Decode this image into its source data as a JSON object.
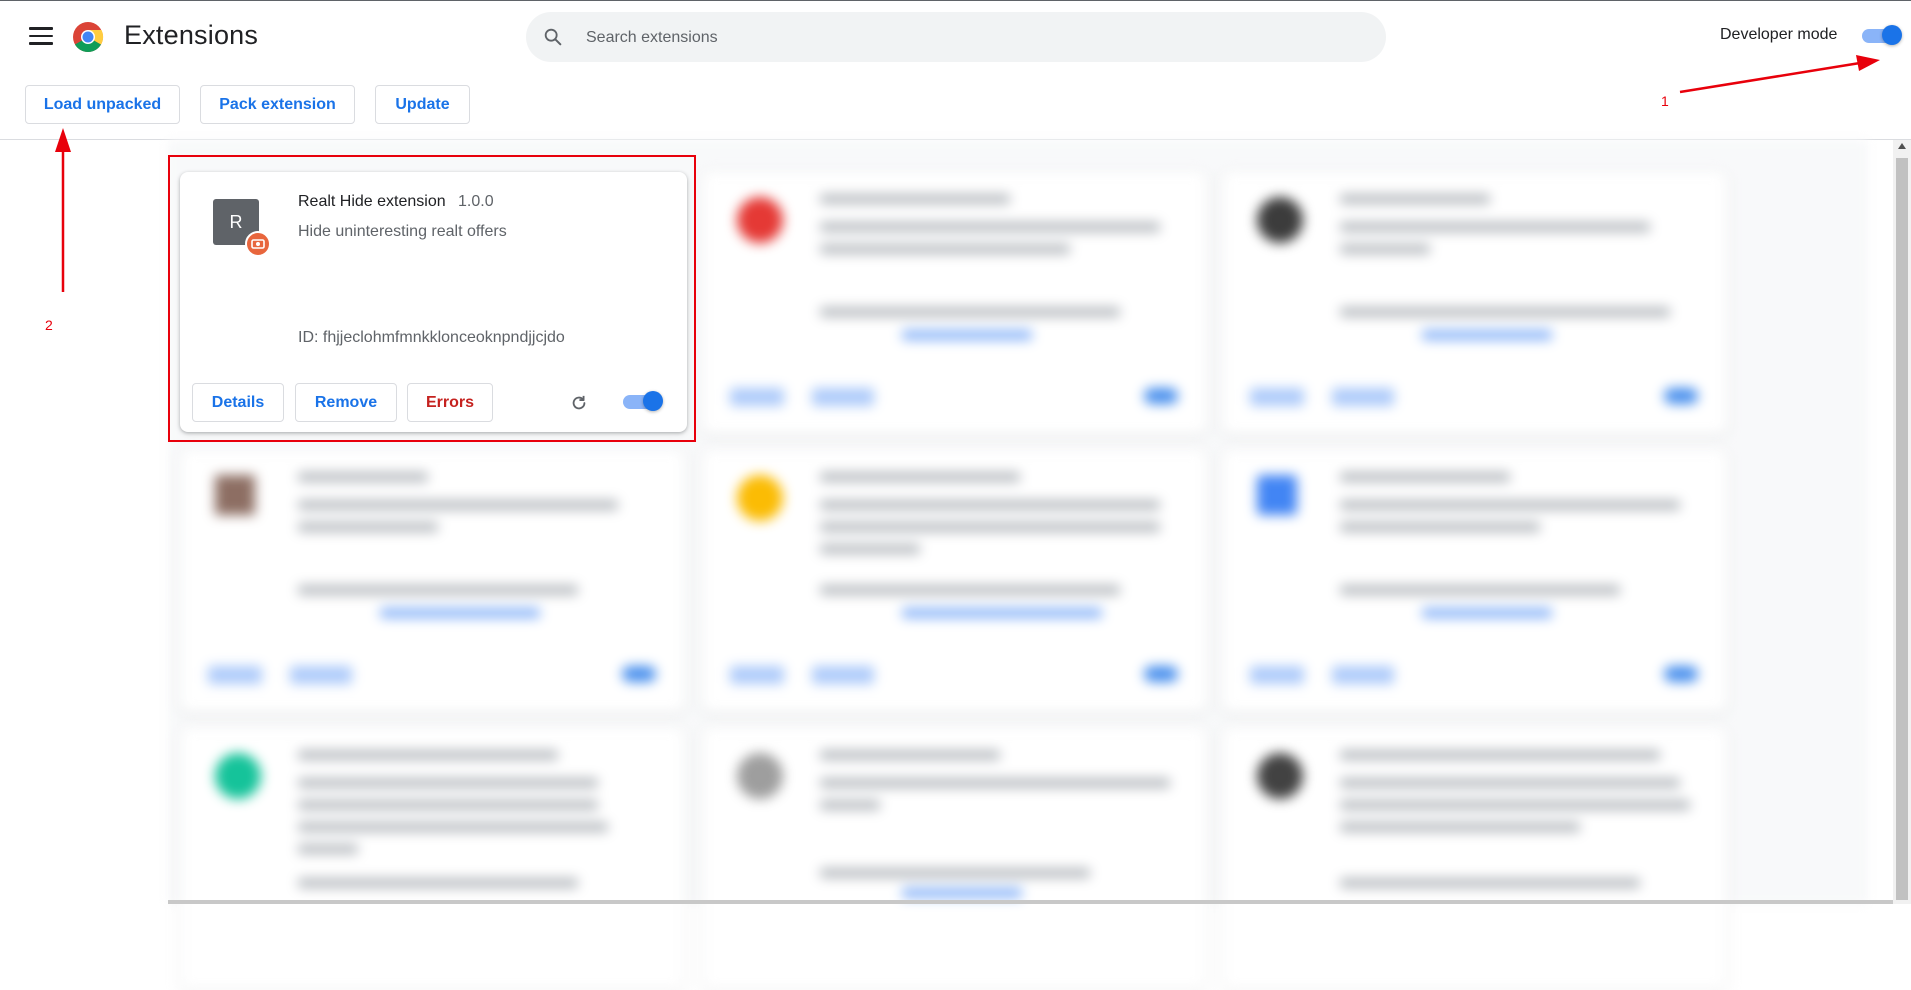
{
  "header": {
    "title": "Extensions",
    "search_placeholder": "Search extensions",
    "developer_mode_label": "Developer mode",
    "developer_mode_on": true
  },
  "toolbar": {
    "load_unpacked": "Load unpacked",
    "pack_extension": "Pack extension",
    "update": "Update"
  },
  "extension": {
    "icon_letter": "R",
    "name": "Realt Hide extension",
    "version": "1.0.0",
    "description": "Hide uninteresting realt offers",
    "id_text": "ID: fhjjeclohmfmnkklonceoknpndjjcjdo",
    "enabled": true,
    "buttons": {
      "details": "Details",
      "remove": "Remove",
      "errors": "Errors"
    }
  },
  "annotations": {
    "label_1": "1",
    "label_2": "2"
  },
  "colors": {
    "accent": "#1a73e8",
    "error": "#c5221f",
    "annotation": "#e8000b"
  }
}
